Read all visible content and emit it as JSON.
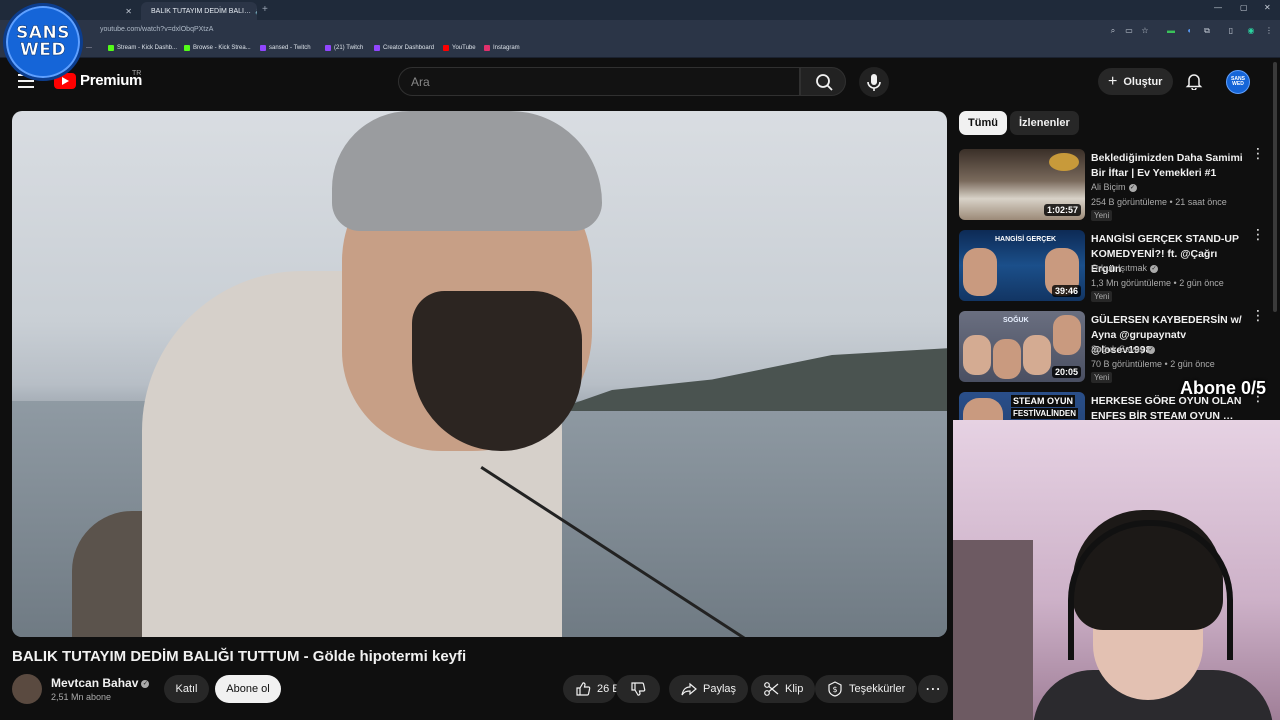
{
  "browser": {
    "tabs": [
      {
        "title": "",
        "active": false
      },
      {
        "title": "BALIK TUTAYIM DEDİM BALI…",
        "active": true
      }
    ],
    "url": "youtube.com/watch?v=dxlObqPXtzA",
    "bookmarks": [
      {
        "label": "Stream - Kick Dashb...",
        "color": "#53fc18"
      },
      {
        "label": "Browse - Kick Strea...",
        "color": "#53fc18"
      },
      {
        "label": "sansed - Twitch",
        "color": "#9146ff"
      },
      {
        "label": "(21) Twitch",
        "color": "#9146ff"
      },
      {
        "label": "Creator Dashboard",
        "color": "#9146ff"
      },
      {
        "label": "YouTube",
        "color": "#ff0000"
      },
      {
        "label": "Instagram",
        "color": "#e1306c"
      }
    ]
  },
  "overlay": {
    "logo_line1": "SANS",
    "logo_line2": "WED",
    "sub_goal": "Abone 0/5"
  },
  "header": {
    "logo_text": "Premium",
    "country": "TR",
    "search_placeholder": "Ara",
    "create_label": "Oluştur",
    "avatar_text": "SANS WED"
  },
  "video": {
    "title": "BALIK TUTAYIM DEDİM BALIĞI TUTTUM - Gölde hipotermi keyfi",
    "channel": "Mevtcan Bahav",
    "subscribers": "2,51 Mn abone",
    "join_label": "Katıl",
    "subscribe_label": "Abone ol",
    "likes": "26 B",
    "share_label": "Paylaş",
    "clip_label": "Klip",
    "thanks_label": "Teşekkürler"
  },
  "sidebar": {
    "chips": [
      "Tümü",
      "İzlenenler"
    ],
    "recommendations": [
      {
        "title": "Beklediğimizden Daha Samimi Bir İftar | Ev Yemekleri #1",
        "channel": "Ali Biçim",
        "meta": "254 B görüntüleme • 21 saat önce",
        "badge": "Yeni",
        "duration": "1:02:57",
        "thumb_color": "#7a6a5c"
      },
      {
        "title": "HANGİSİ GERÇEK STAND-UP KOMEDYENİ?! ft. @Çağrı Ergün",
        "channel": "Orkun Işıtmak",
        "meta": "1,3 Mn görüntüleme • 2 gün önce",
        "badge": "Yeni",
        "duration": "39:46",
        "thumb_color": "#1b4f8a"
      },
      {
        "title": "GÜLERSEN KAYBEDERSİN w/ Ayna @grupaynatv @losev1998",
        "channel": "Soğuk Savaş",
        "meta": "70 B görüntüleme • 2 gün önce",
        "badge": "Yeni",
        "duration": "20:05",
        "thumb_color": "#4a4f62"
      },
      {
        "title": "HERKESE GÖRE OYUN OLAN ENFES BİR STEAM OYUN …",
        "channel": "",
        "meta": "",
        "badge": "",
        "duration": "",
        "thumb_color": "#1e3b66"
      }
    ],
    "thumb_texts": {
      "rec2": "HANGİSİ GERÇEK",
      "rec3": "SOĞUK",
      "rec4_line1": "STEAM OYUN",
      "rec4_line2": "FESTİVALİNDEN"
    }
  }
}
